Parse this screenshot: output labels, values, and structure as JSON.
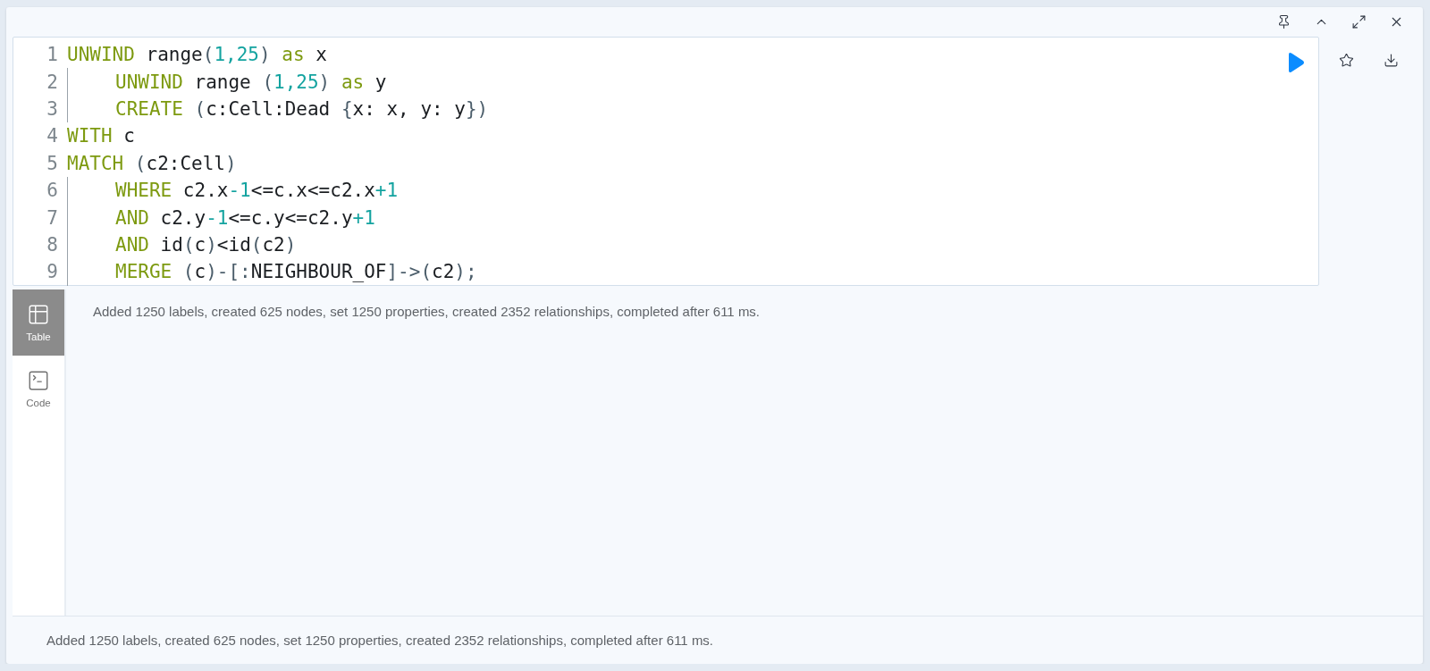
{
  "editor": {
    "lines": [
      {
        "number": "1",
        "tokens": [
          {
            "kind": "keyword",
            "text": "UNWIND"
          },
          {
            "kind": "text",
            "text": " range"
          },
          {
            "kind": "punct",
            "text": "("
          },
          {
            "kind": "number",
            "text": "1,25"
          },
          {
            "kind": "punct",
            "text": ")"
          },
          {
            "kind": "keyword",
            "text": " as"
          },
          {
            "kind": "text",
            "text": " x"
          }
        ],
        "children": [
          {
            "number": "2",
            "tokens": [
              {
                "kind": "keyword",
                "text": "UNWIND"
              },
              {
                "kind": "text",
                "text": " range "
              },
              {
                "kind": "punct",
                "text": "("
              },
              {
                "kind": "number",
                "text": "1,25"
              },
              {
                "kind": "punct",
                "text": ")"
              },
              {
                "kind": "keyword",
                "text": " as"
              },
              {
                "kind": "text",
                "text": " y"
              }
            ]
          },
          {
            "number": "3",
            "tokens": [
              {
                "kind": "keyword",
                "text": "CREATE"
              },
              {
                "kind": "punct",
                "text": " ("
              },
              {
                "kind": "text",
                "text": "c:Cell:Dead "
              },
              {
                "kind": "punct",
                "text": "{"
              },
              {
                "kind": "text",
                "text": "x: x, y: y"
              },
              {
                "kind": "punct",
                "text": "})"
              }
            ]
          }
        ]
      },
      {
        "number": "4",
        "tokens": [
          {
            "kind": "keyword",
            "text": "WITH"
          },
          {
            "kind": "text",
            "text": " c"
          }
        ]
      },
      {
        "number": "5",
        "tokens": [
          {
            "kind": "keyword",
            "text": "MATCH"
          },
          {
            "kind": "punct",
            "text": " ("
          },
          {
            "kind": "text",
            "text": "c2:Cell"
          },
          {
            "kind": "punct",
            "text": ")"
          }
        ],
        "children": [
          {
            "number": "6",
            "tokens": [
              {
                "kind": "keyword",
                "text": "WHERE"
              },
              {
                "kind": "text",
                "text": " c2.x"
              },
              {
                "kind": "number",
                "text": "-1"
              },
              {
                "kind": "text",
                "text": "<=c.x<=c2.x"
              },
              {
                "kind": "number",
                "text": "+1"
              }
            ]
          },
          {
            "number": "7",
            "tokens": [
              {
                "kind": "keyword",
                "text": "AND"
              },
              {
                "kind": "text",
                "text": " c2.y"
              },
              {
                "kind": "number",
                "text": "-1"
              },
              {
                "kind": "text",
                "text": "<=c.y<=c2.y"
              },
              {
                "kind": "number",
                "text": "+1"
              }
            ]
          },
          {
            "number": "8",
            "tokens": [
              {
                "kind": "keyword",
                "text": "AND"
              },
              {
                "kind": "text",
                "text": " id"
              },
              {
                "kind": "punct",
                "text": "("
              },
              {
                "kind": "text",
                "text": "c"
              },
              {
                "kind": "punct",
                "text": ")"
              },
              {
                "kind": "text",
                "text": "<id"
              },
              {
                "kind": "punct",
                "text": "("
              },
              {
                "kind": "text",
                "text": "c2"
              },
              {
                "kind": "punct",
                "text": ")"
              }
            ]
          },
          {
            "number": "9",
            "tokens": [
              {
                "kind": "keyword",
                "text": "MERGE"
              },
              {
                "kind": "punct",
                "text": " ("
              },
              {
                "kind": "text",
                "text": "c"
              },
              {
                "kind": "punct",
                "text": ")-[:"
              },
              {
                "kind": "text",
                "text": "NEIGHBOUR_OF"
              },
              {
                "kind": "punct",
                "text": "]->("
              },
              {
                "kind": "text",
                "text": "c2"
              },
              {
                "kind": "punct",
                "text": ");"
              }
            ]
          }
        ]
      }
    ]
  },
  "view_tabs": [
    {
      "label": "Table",
      "selected": true
    },
    {
      "label": "Code",
      "selected": false
    }
  ],
  "result": {
    "message": "Added 1250 labels, created 625 nodes, set 1250 properties, created 2352 relationships, completed after 611 ms."
  },
  "status_bar": {
    "message": "Added 1250 labels, created 625 nodes, set 1250 properties, created 2352 relationships, completed after 611 ms."
  }
}
